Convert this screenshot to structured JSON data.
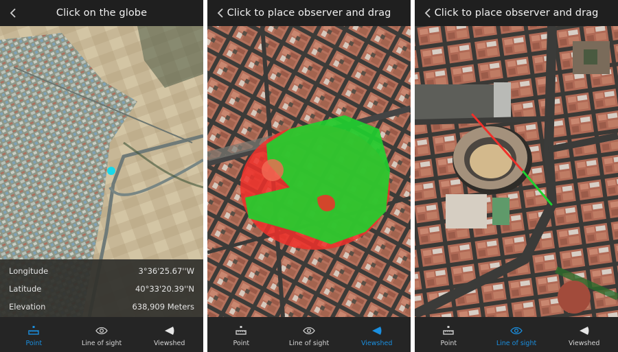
{
  "colors": {
    "accent": "#1a8fe0",
    "header_bg": "#1f1f1f",
    "tabbar_bg": "#252525",
    "marker": "#19d8ea",
    "visible": "#1fd12f",
    "hidden": "#f0302a"
  },
  "panels": [
    {
      "header": {
        "back_icon": "chevron-left-icon",
        "title": "Click on the globe"
      },
      "info": {
        "rows": [
          {
            "label": "Longitude",
            "value": "3°36'25.67''W"
          },
          {
            "label": "Latitude",
            "value": "40°33'20.39''N"
          },
          {
            "label": "Elevation",
            "value": "638,909 Meters"
          }
        ]
      },
      "tabs": [
        {
          "label": "Point",
          "icon": "point-ruler-icon",
          "active": true
        },
        {
          "label": "Line of sight",
          "icon": "eye-icon",
          "active": false
        },
        {
          "label": "Viewshed",
          "icon": "viewshed-cone-icon",
          "active": false
        }
      ]
    },
    {
      "header": {
        "back_icon": "chevron-left-icon",
        "title": "Click to place observer and drag"
      },
      "tabs": [
        {
          "label": "Point",
          "icon": "point-ruler-icon",
          "active": false
        },
        {
          "label": "Line of sight",
          "icon": "eye-icon",
          "active": false
        },
        {
          "label": "Viewshed",
          "icon": "viewshed-cone-icon",
          "active": true
        }
      ]
    },
    {
      "header": {
        "back_icon": "chevron-left-icon",
        "title": "Click to place observer and drag"
      },
      "tabs": [
        {
          "label": "Point",
          "icon": "point-ruler-icon",
          "active": false
        },
        {
          "label": "Line of sight",
          "icon": "eye-icon",
          "active": true
        },
        {
          "label": "Viewshed",
          "icon": "viewshed-cone-icon",
          "active": false
        }
      ]
    }
  ]
}
